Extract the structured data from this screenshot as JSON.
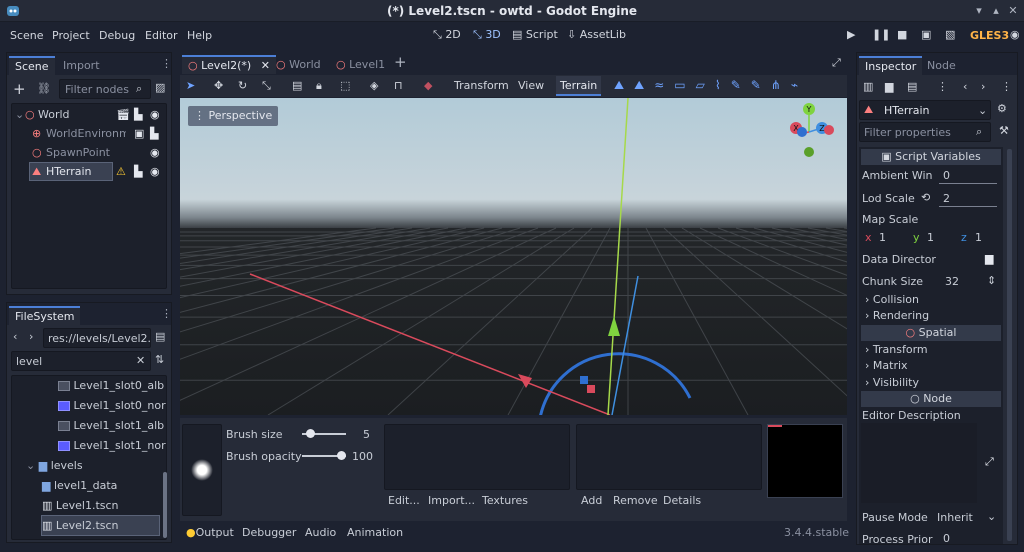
{
  "window": {
    "title": "(*) Level2.tscn - owtd - Godot Engine"
  },
  "menu": [
    "Scene",
    "Project",
    "Debug",
    "Editor",
    "Help"
  ],
  "workspaces": {
    "w2d": "2D",
    "w3d": "3D",
    "script": "Script",
    "assetlib": "AssetLib"
  },
  "renderer": "GLES3",
  "scene_dock": {
    "tabs": [
      "Scene",
      "Import"
    ],
    "filter_placeholder": "Filter nodes",
    "nodes": [
      {
        "name": "World"
      },
      {
        "name": "WorldEnvironme"
      },
      {
        "name": "SpawnPoint"
      },
      {
        "name": "HTerrain"
      }
    ]
  },
  "filesystem": {
    "tab": "FileSystem",
    "path": "res://levels/Level2.t",
    "search": "level",
    "items": [
      "Level1_slot0_alb",
      "Level1_slot0_nor",
      "Level1_slot1_alb",
      "Level1_slot1_nor",
      "levels",
      "level1_data",
      "Level1.tscn",
      "Level2.tscn"
    ]
  },
  "scene_tabs": [
    "Level2(*)",
    "World",
    "Level1"
  ],
  "viewport_toolbar": {
    "transform": "Transform",
    "view": "View",
    "terrain": "Terrain"
  },
  "viewport": {
    "label": "Perspective",
    "gizmo": {
      "y": "Y",
      "x": "X",
      "z": "Z"
    }
  },
  "terrain_panel": {
    "brush_size_label": "Brush size",
    "brush_size_value": "5",
    "brush_size_fraction": 0.1,
    "brush_opacity_label": "Brush opacity",
    "brush_opacity_value": "100",
    "brush_opacity_fraction": 1.0,
    "buttons": {
      "edit": "Edit...",
      "import": "Import...",
      "textures": "Textures",
      "add": "Add",
      "remove": "Remove",
      "details": "Details"
    }
  },
  "bottom_tabs": [
    "Output",
    "Debugger",
    "Audio",
    "Animation"
  ],
  "version": "3.4.4.stable",
  "inspector": {
    "tabs": [
      "Inspector",
      "Node"
    ],
    "object": "HTerrain",
    "filter_placeholder": "Filter properties",
    "script_variables": "Script Variables",
    "ambient_label": "Ambient Win",
    "ambient_value": "0",
    "lod_label": "Lod Scale",
    "lod_value": "2",
    "map_scale_label": "Map Scale",
    "map_scale": {
      "x_label": "x",
      "x": "1",
      "y_label": "y",
      "y": "1",
      "z_label": "z",
      "z": "1"
    },
    "data_director_label": "Data Director",
    "chunk_label": "Chunk Size",
    "chunk_value": "32",
    "groups": [
      "Collision",
      "Rendering"
    ],
    "spatial": "Spatial",
    "spatial_groups": [
      "Transform",
      "Matrix",
      "Visibility"
    ],
    "node_section": "Node",
    "editor_desc": "Editor Description",
    "pause_label": "Pause Mode",
    "pause_value": "Inherit",
    "process_label": "Process Prior",
    "process_value": "0"
  }
}
